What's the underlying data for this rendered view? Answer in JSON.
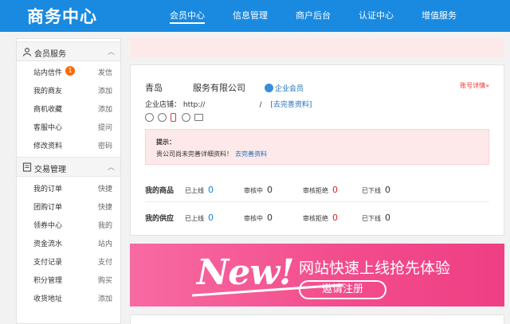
{
  "brand": "商务中心",
  "nav": [
    {
      "label": "会员中心",
      "active": true
    },
    {
      "label": "信息管理",
      "active": false
    },
    {
      "label": "商户后台",
      "active": false
    },
    {
      "label": "认证中心",
      "active": false
    },
    {
      "label": "增值服务",
      "active": false
    }
  ],
  "sidebar": {
    "sections": [
      {
        "title": "会员服务",
        "icon": "person-icon",
        "items": [
          {
            "label": "站内信件",
            "action": "发信",
            "badge": "1"
          },
          {
            "label": "我的商友",
            "action": "添加"
          },
          {
            "label": "商机收藏",
            "action": "添加"
          },
          {
            "label": "客服中心",
            "action": "提问"
          },
          {
            "label": "修改资料",
            "action": "密码"
          }
        ]
      },
      {
        "title": "交易管理",
        "icon": "document-icon",
        "items": [
          {
            "label": "我的订单",
            "action": "快捷"
          },
          {
            "label": "团购订单",
            "action": "快捷"
          },
          {
            "label": "领券中心",
            "action": "我的"
          },
          {
            "label": "资金流水",
            "action": "站内"
          },
          {
            "label": "支付记录",
            "action": "支付"
          },
          {
            "label": "积分管理",
            "action": "购买"
          },
          {
            "label": "收货地址",
            "action": "添加"
          }
        ]
      }
    ]
  },
  "profile": {
    "company_prefix": "青岛",
    "company_suffix": "服务有限公司",
    "member_badge": "企业会员",
    "account_link": "账号详情»",
    "shop_label": "企业店铺：",
    "shop_url_prefix": "http://",
    "shop_url_suffix": "/",
    "complete_link": "[去完善资料]"
  },
  "tip": {
    "title": "提示：",
    "text": "贵公司尚未完善详细资料！",
    "link": "去完善资料"
  },
  "stats": [
    {
      "heading": "我的商品",
      "items": [
        {
          "label": "已上线",
          "value": "0",
          "color": "#1a7fd4"
        },
        {
          "label": "审核中",
          "value": "0",
          "color": "#333333"
        },
        {
          "label": "审核拒绝",
          "value": "0",
          "color": "#e02020"
        },
        {
          "label": "已下线",
          "value": "0",
          "color": "#333333"
        }
      ]
    },
    {
      "heading": "我的供应",
      "items": [
        {
          "label": "已上线",
          "value": "0",
          "color": "#1a7fd4"
        },
        {
          "label": "审核中",
          "value": "0",
          "color": "#333333"
        },
        {
          "label": "审核拒绝",
          "value": "0",
          "color": "#e02020"
        },
        {
          "label": "已下线",
          "value": "0",
          "color": "#333333"
        }
      ]
    }
  ],
  "banner": {
    "new_text": "New!",
    "headline": "网站快速上线抢先体验",
    "button": "邀请注册"
  },
  "colors": {
    "primary": "#1a8ae0",
    "accent_pink": "#f24b8c",
    "alert_red": "#e02020"
  }
}
